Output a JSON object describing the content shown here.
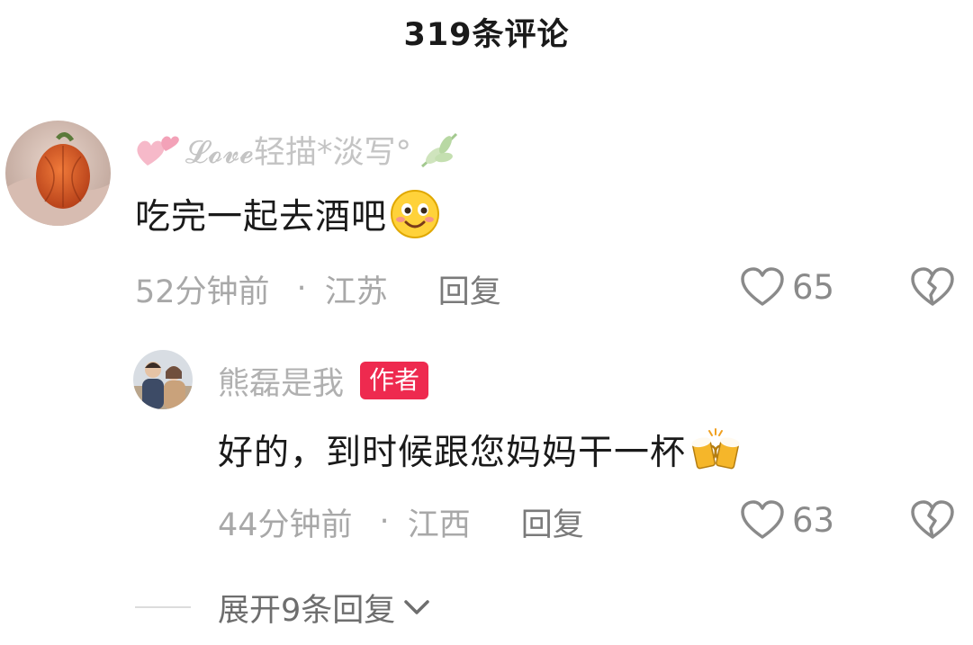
{
  "header": {
    "title": "319条评论"
  },
  "comment": {
    "username": "𝓛𝓸𝓿𝓮轻描*淡写°",
    "text": "吃完一起去酒吧",
    "emoji": "smiley-emoji",
    "time": "52分钟前",
    "separator": "·",
    "location": "江苏",
    "reply_label": "回复",
    "likes": "65"
  },
  "reply": {
    "username": "熊磊是我",
    "badge": "作者",
    "text": "好的，到时候跟您妈妈干一杯",
    "emoji": "beer-cheers-emoji",
    "time": "44分钟前",
    "separator": "·",
    "location": "江西",
    "reply_label": "回复",
    "likes": "63"
  },
  "expand": {
    "label": "展开9条回复"
  },
  "colors": {
    "badge": "#ee2a4f",
    "muted_text": "#a8a8a8",
    "primary_text": "#1a1a1a"
  }
}
